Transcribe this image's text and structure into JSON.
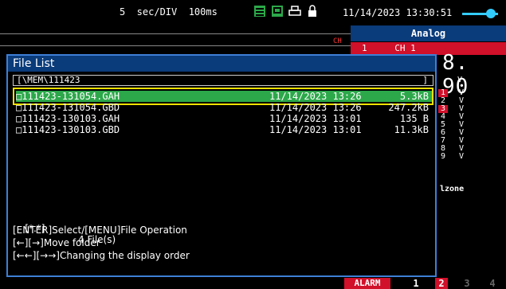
{
  "header": {
    "timebase": "5  sec/DIV  100ms",
    "clock": "11/14/2023 13:30:51",
    "status_icons": [
      "memory-icon",
      "screen-icon",
      "print-icon",
      "lock-icon"
    ]
  },
  "right_panel": {
    "mode": "Analog",
    "channel_num": "1",
    "channel_label": "CH 1",
    "value": "8. 90",
    "value_unit": "V",
    "channels": [
      {
        "num": "1",
        "unit": "V",
        "color": "#d1102a"
      },
      {
        "num": "2",
        "unit": "V",
        "color": "#000000"
      },
      {
        "num": "3",
        "unit": "V",
        "color": "#d1102a"
      },
      {
        "num": "4",
        "unit": "V",
        "color": "#000000"
      },
      {
        "num": "5",
        "unit": "V",
        "color": "#000000"
      },
      {
        "num": "6",
        "unit": "V",
        "color": "#000000"
      },
      {
        "num": "7",
        "unit": "V",
        "color": "#000000"
      },
      {
        "num": "8",
        "unit": "V",
        "color": "#000000"
      },
      {
        "num": "9",
        "unit": "V",
        "color": "#000000"
      }
    ],
    "zone_label": "lzone"
  },
  "left_panel": {
    "ch_marker": "CH"
  },
  "dialog": {
    "title": "File List",
    "path": "[\\MEM\\111423",
    "path_end": "]",
    "files": [
      {
        "name": "□111423-131054.GAH",
        "date": "11/14/2023 13:26",
        "size": "5.3kB"
      },
      {
        "name": "□111423-131054.GBD",
        "date": "11/14/2023 13:26",
        "size": "247.2kB"
      },
      {
        "name": "□111423-130103.GAH",
        "date": "11/14/2023 13:01",
        "size": "135 B"
      },
      {
        "name": "□111423-130103.GBD",
        "date": "11/14/2023 13:01",
        "size": "11.3kB"
      }
    ],
    "filter": "[*.*]",
    "file_count": "4 File(s)",
    "help_lines": [
      "[ENTER]Select/[MENU]File Operation",
      "[←][→]Move folder",
      "[←←][→→]Changing the display order"
    ]
  },
  "footer": {
    "alarm": "ALARM",
    "alarm_channels": [
      {
        "num": "1",
        "color": "#ffffff",
        "bg": "#000000"
      },
      {
        "num": "2",
        "color": "#ffffff",
        "bg": "#d1102a"
      },
      {
        "num": "3",
        "color": "#666666",
        "bg": "#000000"
      },
      {
        "num": "4",
        "color": "#666666",
        "bg": "#000000"
      }
    ]
  }
}
